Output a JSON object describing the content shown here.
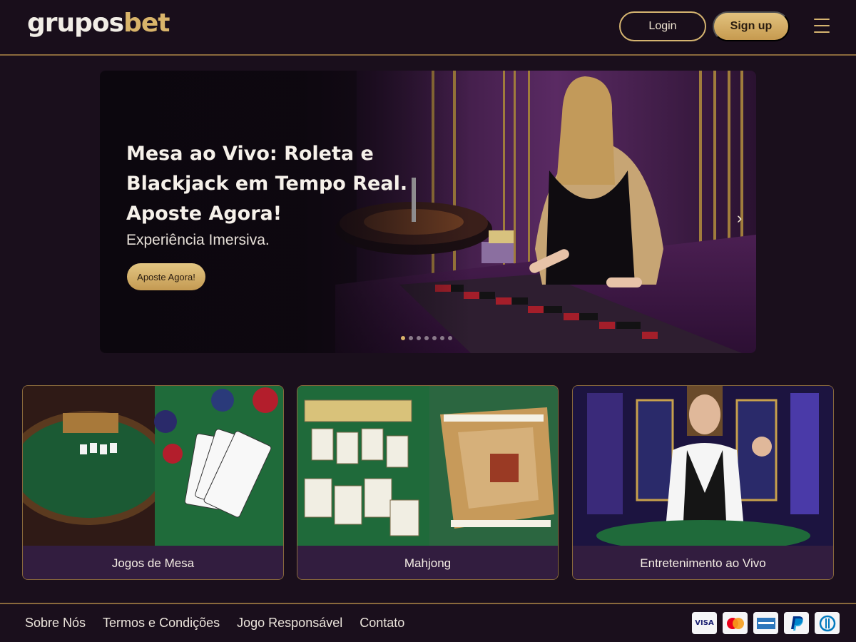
{
  "header": {
    "logo_main": "grupos",
    "logo_accent": "bet",
    "login_label": "Login",
    "signup_label": "Sign up",
    "menu_icon": "hamburger-menu-icon"
  },
  "hero": {
    "title_line1": "Mesa ao Vivo: Roleta e",
    "title_line2": "Blackjack em Tempo Real.",
    "title_line3": "Aposte Agora!",
    "subtitle": "Experiência Imersiva.",
    "cta_label": "Aposte Agora!",
    "next_icon": "chevron-right-icon",
    "slide_count": 7,
    "active_slide": 1
  },
  "categories": [
    {
      "label": "Jogos de Mesa",
      "image": "blackjack-table-and-cards"
    },
    {
      "label": "Mahjong",
      "image": "mahjong-tiles"
    },
    {
      "label": "Entretenimento ao Vivo",
      "image": "live-dealer-studio"
    }
  ],
  "footer": {
    "links": [
      "Sobre Nós",
      "Termos e Condições",
      "Jogo Responsável",
      "Contato"
    ],
    "payments": [
      "VISA",
      "mastercard",
      "AMERICAN EXPRESS",
      "PayPal",
      "Diners Club"
    ]
  },
  "colors": {
    "background": "#1a0f1c",
    "gold_accent": "#d5b470",
    "card_caption": "#321d3f"
  }
}
